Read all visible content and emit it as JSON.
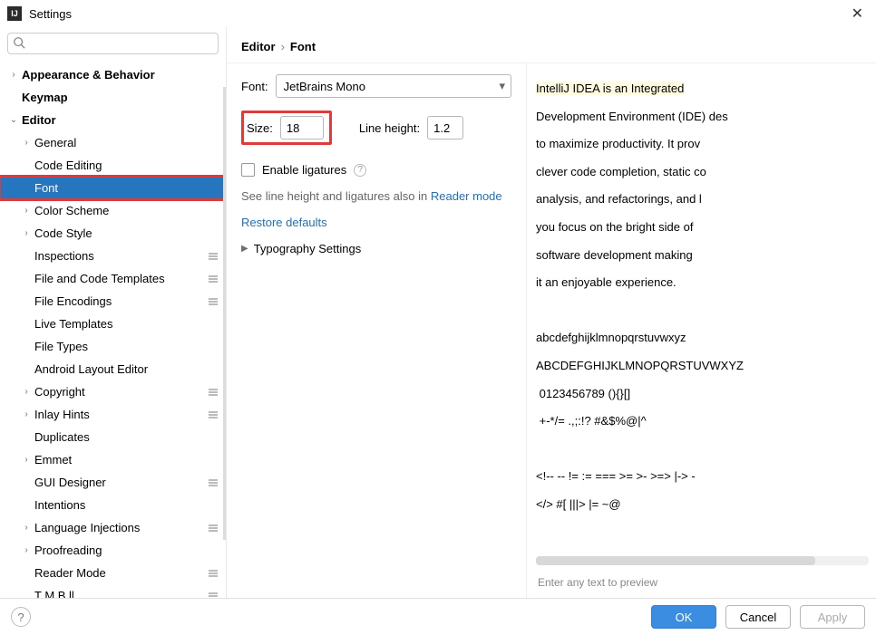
{
  "window": {
    "title": "Settings"
  },
  "search": {
    "placeholder": ""
  },
  "tree": [
    {
      "label": "Appearance & Behavior",
      "indent": 0,
      "chev": "right",
      "bold": true
    },
    {
      "label": "Keymap",
      "indent": 0,
      "chev": "none",
      "bold": true
    },
    {
      "label": "Editor",
      "indent": 0,
      "chev": "down",
      "bold": true
    },
    {
      "label": "General",
      "indent": 1,
      "chev": "right"
    },
    {
      "label": "Code Editing",
      "indent": 1,
      "chev": "none"
    },
    {
      "label": "Font",
      "indent": 1,
      "chev": "none",
      "selected": true,
      "red": true
    },
    {
      "label": "Color Scheme",
      "indent": 1,
      "chev": "right"
    },
    {
      "label": "Code Style",
      "indent": 1,
      "chev": "right"
    },
    {
      "label": "Inspections",
      "indent": 1,
      "chev": "none",
      "cfg": true
    },
    {
      "label": "File and Code Templates",
      "indent": 1,
      "chev": "none",
      "cfg": true
    },
    {
      "label": "File Encodings",
      "indent": 1,
      "chev": "none",
      "cfg": true
    },
    {
      "label": "Live Templates",
      "indent": 1,
      "chev": "none"
    },
    {
      "label": "File Types",
      "indent": 1,
      "chev": "none"
    },
    {
      "label": "Android Layout Editor",
      "indent": 1,
      "chev": "none"
    },
    {
      "label": "Copyright",
      "indent": 1,
      "chev": "right",
      "cfg": true
    },
    {
      "label": "Inlay Hints",
      "indent": 1,
      "chev": "right",
      "cfg": true
    },
    {
      "label": "Duplicates",
      "indent": 1,
      "chev": "none"
    },
    {
      "label": "Emmet",
      "indent": 1,
      "chev": "right"
    },
    {
      "label": "GUI Designer",
      "indent": 1,
      "chev": "none",
      "cfg": true
    },
    {
      "label": "Intentions",
      "indent": 1,
      "chev": "none"
    },
    {
      "label": "Language Injections",
      "indent": 1,
      "chev": "right",
      "cfg": true
    },
    {
      "label": "Proofreading",
      "indent": 1,
      "chev": "right"
    },
    {
      "label": "Reader Mode",
      "indent": 1,
      "chev": "none",
      "cfg": true
    },
    {
      "label": "T  M   B   ll",
      "indent": 1,
      "chev": "none",
      "cfg": true
    }
  ],
  "breadcrumb": {
    "root": "Editor",
    "leaf": "Font"
  },
  "font": {
    "font_label": "Font:",
    "font_value": "JetBrains Mono",
    "size_label": "Size:",
    "size_value": "18",
    "lineheight_label": "Line height:",
    "lineheight_value": "1.2",
    "ligatures_label": "Enable ligatures",
    "hint_prefix": "See line height and ligatures also in ",
    "hint_link": "Reader mode",
    "restore": "Restore defaults",
    "typography": "Typography Settings"
  },
  "preview": {
    "highlight": "IntelliJ IDEA is an Integrated",
    "rest": "\nDevelopment Environment (IDE) des\nto maximize productivity. It prov\nclever code completion, static co\nanalysis, and refactorings, and l\nyou focus on the bright side of\nsoftware development making\nit an enjoyable experience.\n\nabcdefghijklmnopqrstuvwxyz\nABCDEFGHIJKLMNOPQRSTUVWXYZ\n 0123456789 (){}[]\n +-*/= .,;:!? #&$%@|^\n\n<!-- -- != := === >= >- >=> |-> -\n</> #[ |||> |= ~@",
    "input_hint": "Enter any text to preview"
  },
  "buttons": {
    "ok": "OK",
    "cancel": "Cancel",
    "apply": "Apply"
  }
}
